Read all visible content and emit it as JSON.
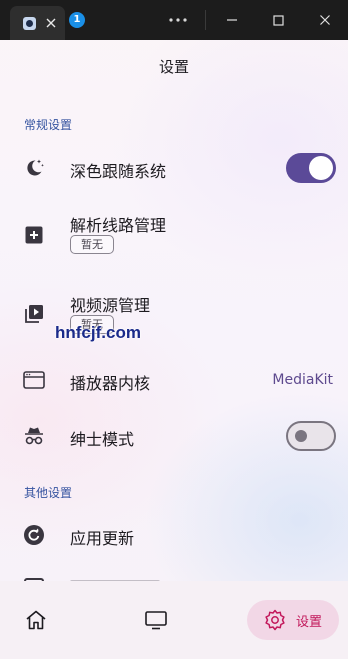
{
  "window": {
    "tab_badge": "1",
    "colors": {
      "titlebar": "#1c1c1c",
      "tab": "#2e2e2e",
      "badge": "#1a8fe6"
    }
  },
  "header": {
    "title": "设置"
  },
  "sections": {
    "general": {
      "label": "常规设置",
      "items": {
        "dark_mode": {
          "label": "深色跟随系统",
          "icon": "moon-stars-icon",
          "toggle": true
        },
        "parser_lines": {
          "label": "解析线路管理",
          "chip": "暂无",
          "icon": "add-box-icon"
        },
        "video_sources": {
          "label": "视频源管理",
          "chip": "暂无",
          "icon": "video-library-icon"
        },
        "player_core": {
          "label": "播放器内核",
          "value": "MediaKit",
          "icon": "window-icon"
        },
        "gentleman_mode": {
          "label": "绅士模式",
          "icon": "incognito-icon",
          "toggle": false
        }
      }
    },
    "other": {
      "label": "其他设置",
      "items": {
        "app_update": {
          "label": "应用更新",
          "icon": "update-icon"
        }
      }
    }
  },
  "watermark": {
    "text": "hnfcjf.com"
  },
  "bottom_nav": {
    "home_icon": "home-icon",
    "tv_icon": "tv-icon",
    "settings_label": "设置",
    "settings_icon": "settings-icon"
  },
  "colors": {
    "accent": "#5b4a98",
    "section_label": "#3553a0",
    "nav_active_bg": "#f2d7e6",
    "nav_active_fg": "#c2185b"
  }
}
